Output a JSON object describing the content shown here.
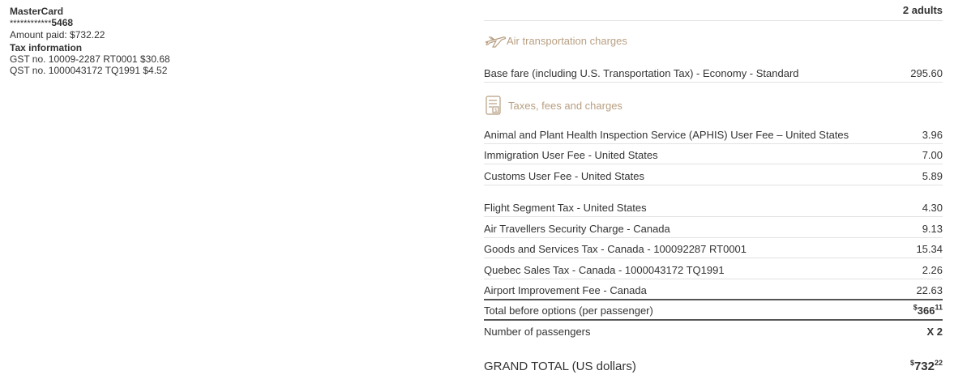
{
  "payment": {
    "card_type": "MasterCard",
    "card_mask": "************",
    "card_last4": "5468",
    "amount_paid": "Amount paid: $732.22",
    "tax_info_title": "Tax information",
    "gst": "GST no. 10009-2287 RT0001 $30.68",
    "qst": "QST no. 1000043172 TQ1991 $4.52"
  },
  "header": {
    "passengers": "2 adults"
  },
  "sections": {
    "air": {
      "title": "Air transportation charges",
      "icon": "airplane-icon"
    },
    "taxes": {
      "title": "Taxes, fees and charges",
      "icon": "receipt-icon"
    }
  },
  "base_fare": {
    "label": "Base fare (including U.S. Transportation Tax) - Economy - Standard",
    "value": "295.60"
  },
  "tax_rows": [
    {
      "label": "Animal and Plant Health Inspection Service (APHIS) User Fee – United States",
      "value": "3.96"
    },
    {
      "label": "Immigration User Fee - United States",
      "value": "7.00"
    },
    {
      "label": "Customs User Fee - United States",
      "value": "5.89"
    },
    {
      "label": "Flight Segment Tax - United States",
      "value": "4.30"
    },
    {
      "label": "Air Travellers Security Charge - Canada",
      "value": "9.13"
    },
    {
      "label": "Goods and Services Tax - Canada - 100092287 RT0001",
      "value": "15.34"
    },
    {
      "label": "Quebec Sales Tax - Canada - 1000043172 TQ1991",
      "value": "2.26"
    },
    {
      "label": "Airport Improvement Fee - Canada",
      "value": "22.63"
    }
  ],
  "total_before": {
    "label": "Total before options (per passenger)",
    "currency": "$",
    "whole": "366",
    "cents": "11"
  },
  "num_passengers": {
    "label": "Number of passengers",
    "value": "X 2"
  },
  "grand_total": {
    "label": "GRAND TOTAL (US dollars)",
    "currency": "$",
    "whole": "732",
    "cents": "22"
  },
  "colors": {
    "section_title": "#b89f82",
    "divider": "#e2e2e2",
    "text": "#333333"
  }
}
